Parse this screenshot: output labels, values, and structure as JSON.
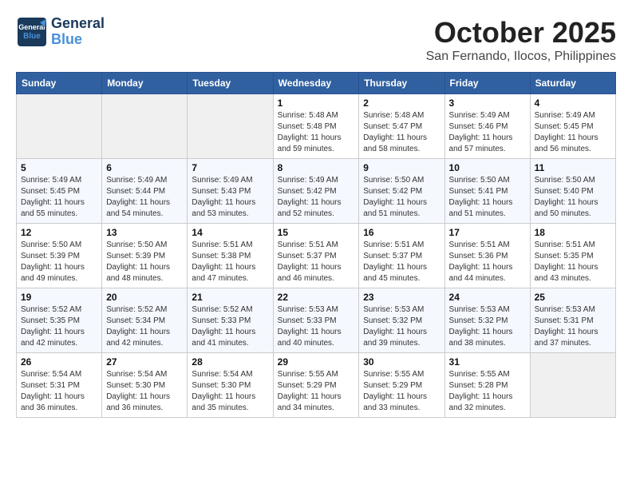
{
  "logo": {
    "line1": "General",
    "line2": "Blue"
  },
  "title": "October 2025",
  "location": "San Fernando, Ilocos, Philippines",
  "weekdays": [
    "Sunday",
    "Monday",
    "Tuesday",
    "Wednesday",
    "Thursday",
    "Friday",
    "Saturday"
  ],
  "weeks": [
    [
      {
        "day": "",
        "info": ""
      },
      {
        "day": "",
        "info": ""
      },
      {
        "day": "",
        "info": ""
      },
      {
        "day": "1",
        "info": "Sunrise: 5:48 AM\nSunset: 5:48 PM\nDaylight: 11 hours\nand 59 minutes."
      },
      {
        "day": "2",
        "info": "Sunrise: 5:48 AM\nSunset: 5:47 PM\nDaylight: 11 hours\nand 58 minutes."
      },
      {
        "day": "3",
        "info": "Sunrise: 5:49 AM\nSunset: 5:46 PM\nDaylight: 11 hours\nand 57 minutes."
      },
      {
        "day": "4",
        "info": "Sunrise: 5:49 AM\nSunset: 5:45 PM\nDaylight: 11 hours\nand 56 minutes."
      }
    ],
    [
      {
        "day": "5",
        "info": "Sunrise: 5:49 AM\nSunset: 5:45 PM\nDaylight: 11 hours\nand 55 minutes."
      },
      {
        "day": "6",
        "info": "Sunrise: 5:49 AM\nSunset: 5:44 PM\nDaylight: 11 hours\nand 54 minutes."
      },
      {
        "day": "7",
        "info": "Sunrise: 5:49 AM\nSunset: 5:43 PM\nDaylight: 11 hours\nand 53 minutes."
      },
      {
        "day": "8",
        "info": "Sunrise: 5:49 AM\nSunset: 5:42 PM\nDaylight: 11 hours\nand 52 minutes."
      },
      {
        "day": "9",
        "info": "Sunrise: 5:50 AM\nSunset: 5:42 PM\nDaylight: 11 hours\nand 51 minutes."
      },
      {
        "day": "10",
        "info": "Sunrise: 5:50 AM\nSunset: 5:41 PM\nDaylight: 11 hours\nand 51 minutes."
      },
      {
        "day": "11",
        "info": "Sunrise: 5:50 AM\nSunset: 5:40 PM\nDaylight: 11 hours\nand 50 minutes."
      }
    ],
    [
      {
        "day": "12",
        "info": "Sunrise: 5:50 AM\nSunset: 5:39 PM\nDaylight: 11 hours\nand 49 minutes."
      },
      {
        "day": "13",
        "info": "Sunrise: 5:50 AM\nSunset: 5:39 PM\nDaylight: 11 hours\nand 48 minutes."
      },
      {
        "day": "14",
        "info": "Sunrise: 5:51 AM\nSunset: 5:38 PM\nDaylight: 11 hours\nand 47 minutes."
      },
      {
        "day": "15",
        "info": "Sunrise: 5:51 AM\nSunset: 5:37 PM\nDaylight: 11 hours\nand 46 minutes."
      },
      {
        "day": "16",
        "info": "Sunrise: 5:51 AM\nSunset: 5:37 PM\nDaylight: 11 hours\nand 45 minutes."
      },
      {
        "day": "17",
        "info": "Sunrise: 5:51 AM\nSunset: 5:36 PM\nDaylight: 11 hours\nand 44 minutes."
      },
      {
        "day": "18",
        "info": "Sunrise: 5:51 AM\nSunset: 5:35 PM\nDaylight: 11 hours\nand 43 minutes."
      }
    ],
    [
      {
        "day": "19",
        "info": "Sunrise: 5:52 AM\nSunset: 5:35 PM\nDaylight: 11 hours\nand 42 minutes."
      },
      {
        "day": "20",
        "info": "Sunrise: 5:52 AM\nSunset: 5:34 PM\nDaylight: 11 hours\nand 42 minutes."
      },
      {
        "day": "21",
        "info": "Sunrise: 5:52 AM\nSunset: 5:33 PM\nDaylight: 11 hours\nand 41 minutes."
      },
      {
        "day": "22",
        "info": "Sunrise: 5:53 AM\nSunset: 5:33 PM\nDaylight: 11 hours\nand 40 minutes."
      },
      {
        "day": "23",
        "info": "Sunrise: 5:53 AM\nSunset: 5:32 PM\nDaylight: 11 hours\nand 39 minutes."
      },
      {
        "day": "24",
        "info": "Sunrise: 5:53 AM\nSunset: 5:32 PM\nDaylight: 11 hours\nand 38 minutes."
      },
      {
        "day": "25",
        "info": "Sunrise: 5:53 AM\nSunset: 5:31 PM\nDaylight: 11 hours\nand 37 minutes."
      }
    ],
    [
      {
        "day": "26",
        "info": "Sunrise: 5:54 AM\nSunset: 5:31 PM\nDaylight: 11 hours\nand 36 minutes."
      },
      {
        "day": "27",
        "info": "Sunrise: 5:54 AM\nSunset: 5:30 PM\nDaylight: 11 hours\nand 36 minutes."
      },
      {
        "day": "28",
        "info": "Sunrise: 5:54 AM\nSunset: 5:30 PM\nDaylight: 11 hours\nand 35 minutes."
      },
      {
        "day": "29",
        "info": "Sunrise: 5:55 AM\nSunset: 5:29 PM\nDaylight: 11 hours\nand 34 minutes."
      },
      {
        "day": "30",
        "info": "Sunrise: 5:55 AM\nSunset: 5:29 PM\nDaylight: 11 hours\nand 33 minutes."
      },
      {
        "day": "31",
        "info": "Sunrise: 5:55 AM\nSunset: 5:28 PM\nDaylight: 11 hours\nand 32 minutes."
      },
      {
        "day": "",
        "info": ""
      }
    ]
  ]
}
